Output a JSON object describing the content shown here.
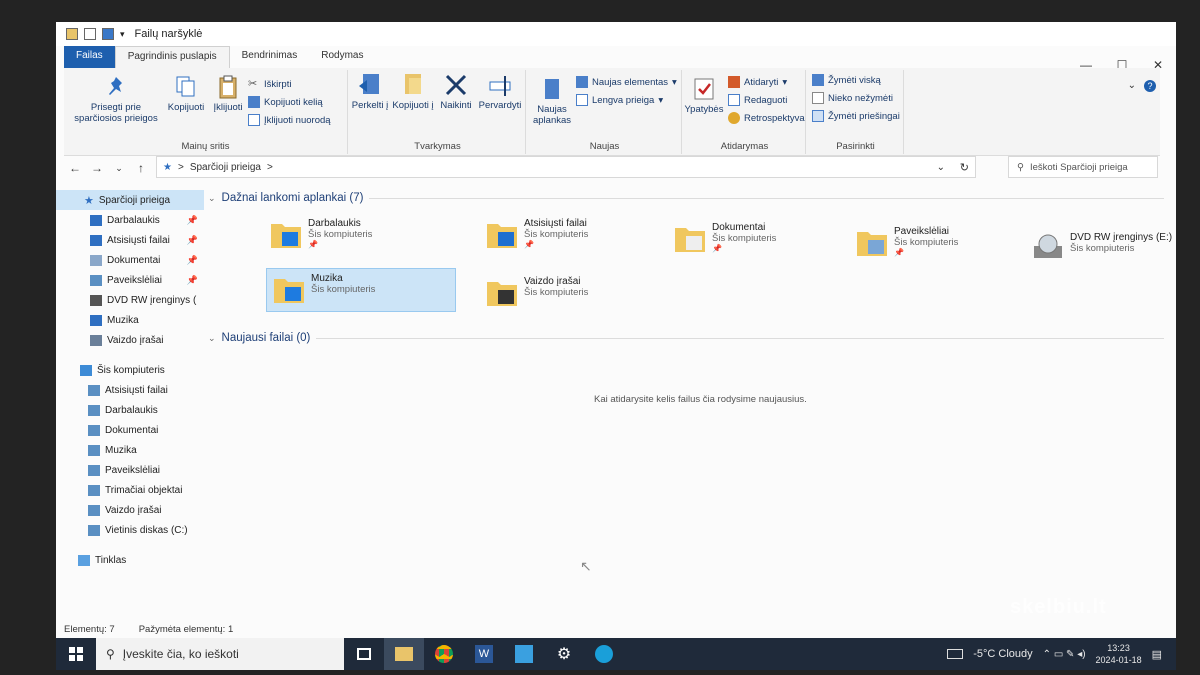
{
  "window": {
    "title": "Failų naršyklė",
    "controls": [
      "—",
      "☐",
      "✕"
    ]
  },
  "tabs": [
    {
      "label": "Failas"
    },
    {
      "label": "Pagrindinis puslapis"
    },
    {
      "label": "Bendrinimas"
    },
    {
      "label": "Rodymas"
    }
  ],
  "ribbon": {
    "iskarpines": {
      "label": "Mainų sritis",
      "pin": "Prisegti prie sparčiosios prieigos",
      "copy": "Kopijuoti",
      "paste": "Įklijuoti",
      "cut": "Iškirpti",
      "copy_path": "Kopijuoti kelią",
      "paste_shortcut": "Įklijuoti nuorodą"
    },
    "tvarkymas": {
      "label": "Tvarkymas",
      "move": "Perkelti į",
      "copy_to": "Kopijuoti į",
      "delete": "Naikinti",
      "rename": "Pervardyti"
    },
    "naujas": {
      "label": "Naujas",
      "new_folder": "Naujas aplankas",
      "new_item": "Naujas elementas",
      "easy_access": "Lengva prieiga"
    },
    "atidarymas": {
      "label": "Atidarymas",
      "properties": "Ypatybės",
      "open": "Atidaryti",
      "edit": "Redaguoti",
      "history": "Retrospektyva"
    },
    "pasirinkti": {
      "label": "Pasirinkti",
      "select_all": "Žymėti viską",
      "select_none": "Nieko nežymėti",
      "invert": "Žymėti priešingai"
    }
  },
  "address": {
    "path": "Sparčioji prieiga",
    "sep": ">",
    "search_placeholder": "Ieškoti Sparčioji prieiga"
  },
  "navpane": {
    "quick_access": "Sparčioji prieiga",
    "quick_items": [
      {
        "label": "Darbalaukis",
        "pin": "📌"
      },
      {
        "label": "Atsisiųsti failai",
        "pin": "📌"
      },
      {
        "label": "Dokumentai",
        "pin": "📌"
      },
      {
        "label": "Paveikslėliai",
        "pin": "📌"
      },
      {
        "label": "DVD RW įrenginys (",
        "pin": ""
      },
      {
        "label": "Muzika",
        "pin": ""
      },
      {
        "label": "Vaizdo įrašai",
        "pin": ""
      }
    ],
    "this_pc": "Šis kompiuteris",
    "pc_items": [
      {
        "label": "Atsisiųsti failai"
      },
      {
        "label": "Darbalaukis"
      },
      {
        "label": "Dokumentai"
      },
      {
        "label": "Muzika"
      },
      {
        "label": "Paveikslėliai"
      },
      {
        "label": "Trimačiai objektai"
      },
      {
        "label": "Vaizdo įrašai"
      },
      {
        "label": "Vietinis diskas (C:)"
      }
    ],
    "network": "Tinklas"
  },
  "main": {
    "frequent_header": "Dažnai lankomi aplankai (7)",
    "recent_header": "Naujausi failai (0)",
    "empty_message": "Kai atidarysite kelis failus čia rodysime naujausius.",
    "folders": [
      {
        "name": "Darbalaukis",
        "sub": "Šis kompiuteris",
        "pin": "📌"
      },
      {
        "name": "Atsisiųsti failai",
        "sub": "Šis kompiuteris",
        "pin": "📌"
      },
      {
        "name": "Dokumentai",
        "sub": "Šis kompiuteris",
        "pin": "📌"
      },
      {
        "name": "Paveikslėliai",
        "sub": "Šis kompiuteris",
        "pin": "📌"
      },
      {
        "name": "DVD RW įrenginys (E:)",
        "sub": "Šis kompiuteris",
        "pin": ""
      },
      {
        "name": "Muzika",
        "sub": "Šis kompiuteris",
        "pin": ""
      },
      {
        "name": "Vaizdo įrašai",
        "sub": "Šis kompiuteris",
        "pin": ""
      }
    ]
  },
  "status": {
    "items": "Elementų: 7",
    "selected": "Pažymėta elementų: 1"
  },
  "taskbar": {
    "search_placeholder": "Įveskite čia, ko ieškoti",
    "weather": "-5°C  Cloudy",
    "time": "13:23",
    "date": "2024-01-18"
  },
  "watermark": "skelbiu.lt",
  "colors": {
    "accent": "#1e5fae",
    "selection": "#cce4f7",
    "taskbar": "#1f2a3a"
  }
}
